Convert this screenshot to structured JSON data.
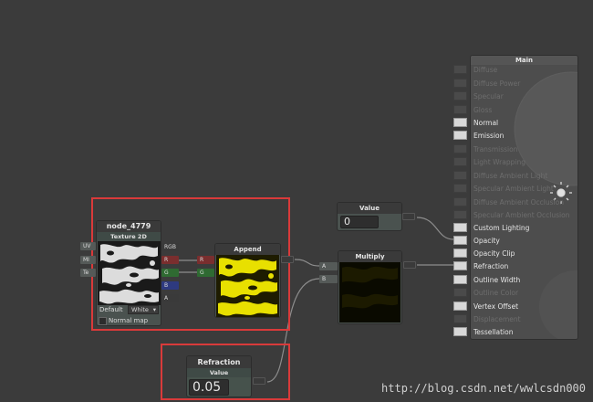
{
  "colors": {
    "canvas": "#3b3b3b",
    "highlight": "#d93a3a",
    "port_r": "#7a2e2e",
    "port_g": "#2f6a32",
    "port_b": "#2e3a80",
    "yellow_noise": "#e8e000"
  },
  "texture_node": {
    "name": "node_4779",
    "type": "Texture 2D",
    "inputs": [
      "UV",
      "MI",
      "Te"
    ],
    "outputs": [
      "RGB",
      "R",
      "G",
      "B",
      "A"
    ],
    "default_label": "Default",
    "default_value": "White",
    "normal_map_label": "Normal map"
  },
  "append_node": {
    "title": "Append",
    "inputs": [
      "R",
      "G"
    ]
  },
  "value_node": {
    "title": "Value",
    "value": "0"
  },
  "multiply_node": {
    "title": "Multiply",
    "inputs": [
      "A",
      "B"
    ]
  },
  "refraction_node": {
    "title": "Refraction",
    "subtitle": "Value",
    "value": "0.05"
  },
  "main_node": {
    "title": "Main",
    "inputs": [
      {
        "label": "Diffuse",
        "active": false
      },
      {
        "label": "Diffuse Power",
        "active": false
      },
      {
        "label": "Specular",
        "active": false
      },
      {
        "label": "Gloss",
        "active": false
      },
      {
        "label": "Normal",
        "active": true
      },
      {
        "label": "Emission",
        "active": true
      },
      {
        "label": "Transmission",
        "active": false
      },
      {
        "label": "Light Wrapping",
        "active": false
      },
      {
        "label": "Diffuse Ambient Light",
        "active": false
      },
      {
        "label": "Specular Ambient Light",
        "active": false
      },
      {
        "label": "Diffuse Ambient Occlusion",
        "active": false
      },
      {
        "label": "Specular Ambient Occlusion",
        "active": false
      },
      {
        "label": "Custom Lighting",
        "active": true
      },
      {
        "label": "Opacity",
        "active": true
      },
      {
        "label": "Opacity Clip",
        "active": true
      },
      {
        "label": "Refraction",
        "active": true
      },
      {
        "label": "Outline Width",
        "active": true
      },
      {
        "label": "Outline Color",
        "active": false
      },
      {
        "label": "Vertex Offset",
        "active": true
      },
      {
        "label": "Displacement",
        "active": false
      },
      {
        "label": "Tessellation",
        "active": true
      }
    ]
  },
  "watermark": "http://blog.csdn.net/wwlcsdn000"
}
